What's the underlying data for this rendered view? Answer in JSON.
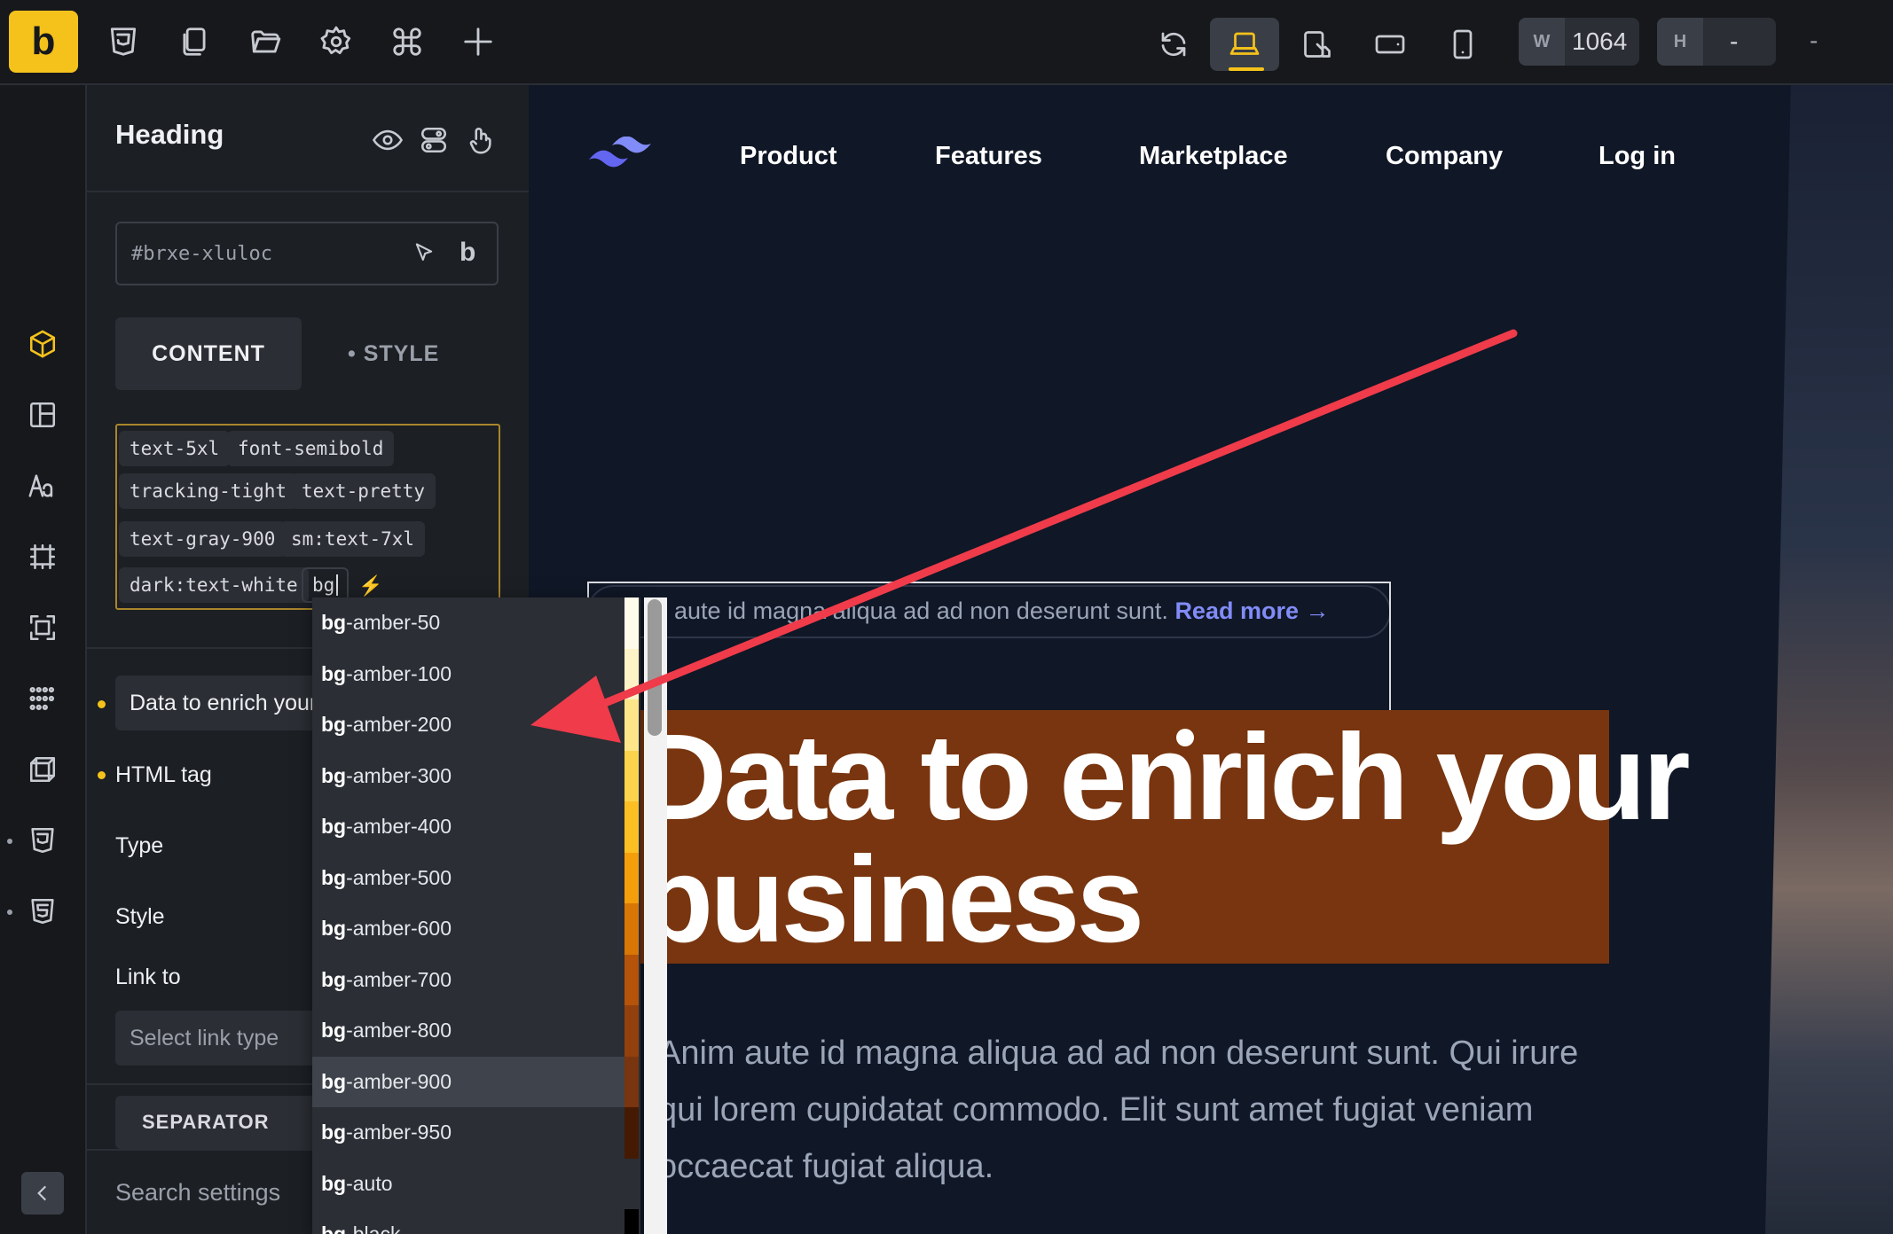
{
  "toolbar": {
    "logo_letter": "b",
    "left_icons": [
      "css3-icon",
      "copy-icon",
      "folder-icon",
      "gear-icon",
      "command-icon",
      "plus-icon"
    ],
    "device_icons": [
      "refresh-icon",
      "laptop-icon",
      "tablet-landscape-icon",
      "tablet-icon",
      "phone-icon"
    ],
    "width": {
      "tag": "W",
      "value": "1064"
    },
    "height": {
      "tag": "H",
      "value": "-"
    },
    "extra": "-"
  },
  "panel": {
    "title": "Heading",
    "element_id": "#brxe-xluloc",
    "id_field_letter": "b",
    "tabs": {
      "content": "CONTENT",
      "style": "• STYLE"
    },
    "classes": [
      "text-5xl",
      "font-semibold",
      "tracking-tight",
      "text-pretty",
      "text-gray-900",
      "sm:text-7xl",
      "dark:text-white"
    ],
    "class_input": "bg",
    "bolt": "⚡",
    "text_value": "Data to enrich your business",
    "fields": {
      "html_tag": "HTML tag",
      "type": "Type",
      "style": "Style",
      "link_to": "Link to"
    },
    "link_placeholder": "Select link type",
    "separator_label": "SEPARATOR",
    "search_placeholder": "Search settings"
  },
  "site": {
    "nav": [
      "Product",
      "Features",
      "Marketplace",
      "Company",
      "Log in"
    ],
    "announcement": "aute id magna aliqua ad ad non deserunt sunt.",
    "announcement_link": "Read more →",
    "hero_line1": "Data to enrich your",
    "hero_line2": "business",
    "paragraph": "Anim aute id magna aliqua ad ad non deserunt sunt. Qui irure\nqui lorem cupidatat commodo. Elit sunt amet fugiat veniam\noccaecat fugiat aliqua."
  },
  "dropdown": {
    "prefix": "bg",
    "items": [
      {
        "suffix": "-amber-50",
        "swatch": "#fffbeb"
      },
      {
        "suffix": "-amber-100",
        "swatch": "#fef3c7"
      },
      {
        "suffix": "-amber-200",
        "swatch": "#fde68a"
      },
      {
        "suffix": "-amber-300",
        "swatch": "#fcd34d"
      },
      {
        "suffix": "-amber-400",
        "swatch": "#fbbf24"
      },
      {
        "suffix": "-amber-500",
        "swatch": "#f59e0b"
      },
      {
        "suffix": "-amber-600",
        "swatch": "#d97706"
      },
      {
        "suffix": "-amber-700",
        "swatch": "#b45309"
      },
      {
        "suffix": "-amber-800",
        "swatch": "#92400e"
      },
      {
        "suffix": "-amber-900",
        "swatch": "#78350f"
      },
      {
        "suffix": "-amber-950",
        "swatch": "#451a03"
      },
      {
        "suffix": "-auto",
        "swatch": ""
      },
      {
        "suffix": "-black",
        "swatch": "#000000"
      }
    ],
    "highlighted_index": 9
  },
  "colors": {
    "accent": "#f5c21b",
    "hero_background": "#78350f",
    "link": "#818cf8",
    "annotation_arrow": "#ef3b4a"
  }
}
